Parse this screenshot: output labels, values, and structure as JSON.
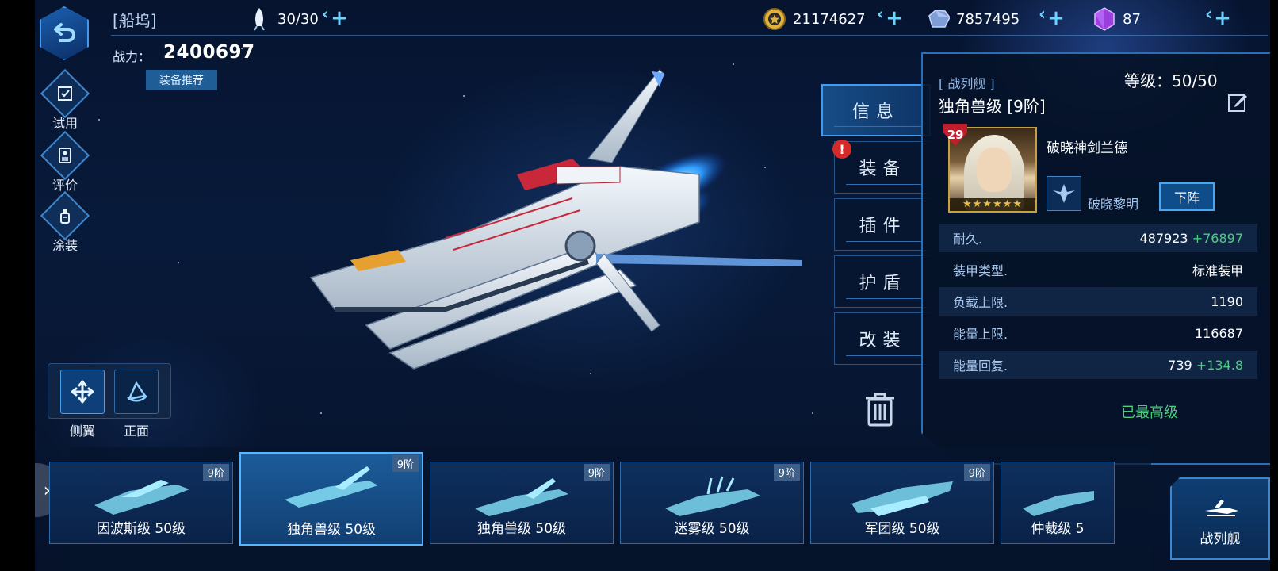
{
  "header": {
    "title": "[船坞]",
    "fleet_count": "30/30",
    "power_label": "战力：",
    "power_value": "2400697",
    "equip_recommend": "装备推荐"
  },
  "resources": [
    {
      "name": "gold",
      "icon": "gold-coin-icon",
      "value": "21174627"
    },
    {
      "name": "ore",
      "icon": "crystal-ore-icon",
      "value": "7857495"
    },
    {
      "name": "gem",
      "icon": "purple-gem-icon",
      "value": "87"
    }
  ],
  "side_menu": [
    {
      "icon": "checklist-icon",
      "label": "试用"
    },
    {
      "icon": "rating-icon",
      "label": "评价"
    },
    {
      "icon": "paint-icon",
      "label": "涂装"
    }
  ],
  "view_controls": [
    {
      "icon": "move-arrows-icon",
      "label": "侧翼"
    },
    {
      "icon": "front-view-icon",
      "label": "正面"
    }
  ],
  "tabs": [
    {
      "label": "信息",
      "active": true
    },
    {
      "label": "装备",
      "alert": "!"
    },
    {
      "label": "插件"
    },
    {
      "label": "护盾"
    },
    {
      "label": "改装"
    }
  ],
  "info": {
    "ship_class": "[ 战列舰 ]",
    "ship_name": "独角兽级 [9阶]",
    "level": "等级：50/50",
    "captain_level": "29",
    "captain_stars": "★★★★★★",
    "captain_name": "破晓神剑兰德",
    "fleet_name": "破晓黎明",
    "dismiss": "下阵",
    "stats": [
      {
        "label": "耐久.",
        "value": "487923",
        "bonus": "+76897"
      },
      {
        "label": "装甲类型.",
        "value": "标准装甲",
        "bonus": ""
      },
      {
        "label": "负载上限.",
        "value": "1190",
        "bonus": ""
      },
      {
        "label": "能量上限.",
        "value": "116687",
        "bonus": ""
      },
      {
        "label": "能量回复.",
        "value": "739",
        "bonus": "+134.8"
      }
    ],
    "max_level": "已最高级"
  },
  "ships": [
    {
      "tier": "9阶",
      "name": "因波斯级 50级",
      "selected": false
    },
    {
      "tier": "9阶",
      "name": "独角兽级 50级",
      "selected": true
    },
    {
      "tier": "9阶",
      "name": "独角兽级 50级",
      "selected": false
    },
    {
      "tier": "9阶",
      "name": "迷雾级 50级",
      "selected": false
    },
    {
      "tier": "9阶",
      "name": "军团级 50级",
      "selected": false
    },
    {
      "tier": "",
      "name": "仲裁级 5",
      "selected": false
    }
  ],
  "ship_type_button": "战列舰",
  "colors": {
    "accent": "#3f9af0",
    "bonus": "#4ad07c",
    "alert": "#d42a2a"
  }
}
